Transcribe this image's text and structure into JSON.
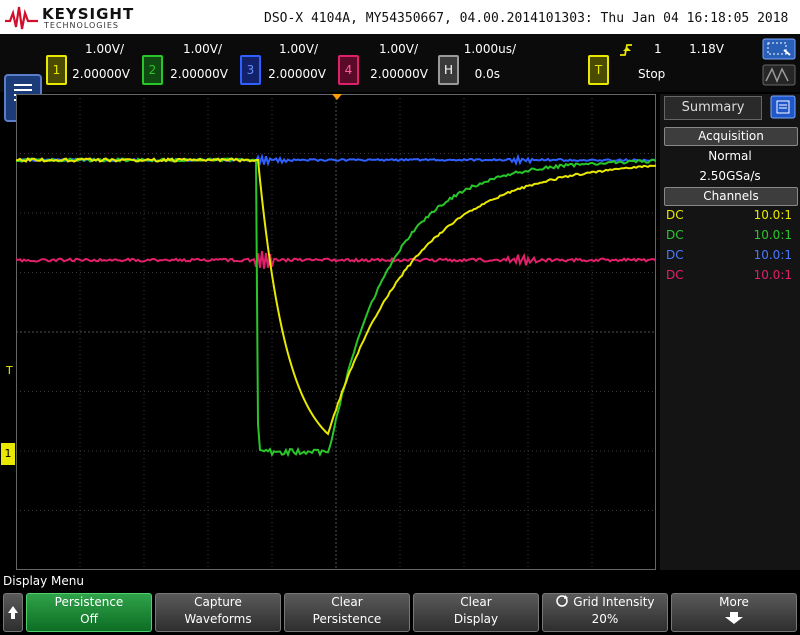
{
  "brand": {
    "name": "KEYSIGHT",
    "sub": "TECHNOLOGIES"
  },
  "title": "DSO-X 4104A, MY54350667, 04.00.2014101303: Thu Jan 04 16:18:05 2018",
  "channels": [
    {
      "num": "1",
      "scale": "1.00V/",
      "offset": "2.00000V",
      "color": "#e8e800"
    },
    {
      "num": "2",
      "scale": "1.00V/",
      "offset": "2.00000V",
      "color": "#29c629"
    },
    {
      "num": "3",
      "scale": "1.00V/",
      "offset": "2.00000V",
      "color": "#3060ff"
    },
    {
      "num": "4",
      "scale": "1.00V/",
      "offset": "2.00000V",
      "color": "#e0206a"
    }
  ],
  "horizontal": {
    "key": "H",
    "scale": "1.000us/",
    "delay": "0.0s"
  },
  "trigger": {
    "key": "T",
    "edge_icon": "rising-edge-icon",
    "source": "1",
    "level": "1.18V",
    "state": "Stop"
  },
  "side_panel": {
    "tab": "Summary",
    "acquisition_header": "Acquisition",
    "mode": "Normal",
    "rate": "2.50GSa/s",
    "channels_header": "Channels",
    "rows": [
      {
        "coupling": "DC",
        "probe": "10.0:1",
        "color": "#e8e800"
      },
      {
        "coupling": "DC",
        "probe": "10.0:1",
        "color": "#29c629"
      },
      {
        "coupling": "DC",
        "probe": "10.0:1",
        "color": "#3060ff"
      },
      {
        "coupling": "DC",
        "probe": "10.0:1",
        "color": "#e0206a"
      }
    ]
  },
  "markers": {
    "trigger_level": "T",
    "ch1_ground": "1"
  },
  "menu": {
    "label": "Display Menu",
    "softkeys": [
      {
        "line1": "Persistence",
        "line2": "Off",
        "active": true
      },
      {
        "line1": "Capture",
        "line2": "Waveforms",
        "active": false
      },
      {
        "line1": "Clear",
        "line2": "Persistence",
        "active": false
      },
      {
        "line1": "Clear",
        "line2": "Display",
        "active": false
      },
      {
        "line1": "Grid Intensity",
        "line2": "20%",
        "active": false
      },
      {
        "line1": "More",
        "line2": "",
        "active": false
      }
    ]
  }
}
